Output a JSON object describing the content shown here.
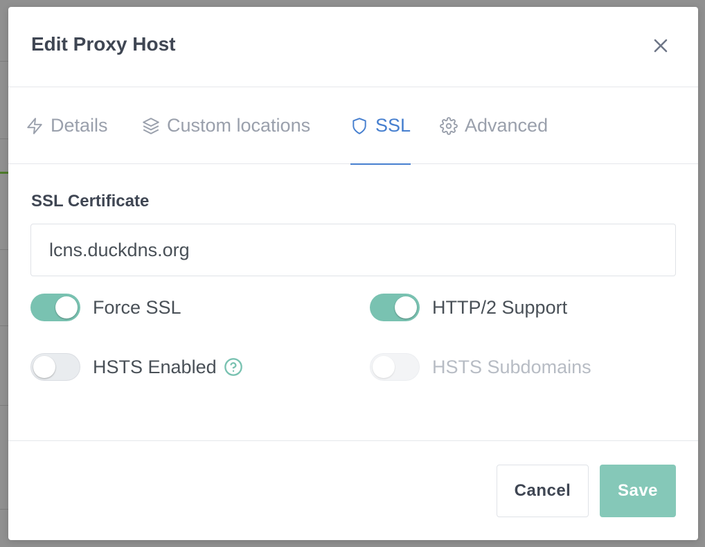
{
  "modal": {
    "title": "Edit Proxy Host",
    "close_icon": "close-icon"
  },
  "tabs": [
    {
      "label": "Details",
      "icon": "lightning-icon",
      "active": false
    },
    {
      "label": "Custom locations",
      "icon": "layers-icon",
      "active": false
    },
    {
      "label": "SSL",
      "icon": "shield-icon",
      "active": true
    },
    {
      "label": "Advanced",
      "icon": "gear-icon",
      "active": false
    }
  ],
  "ssl": {
    "certificate_label": "SSL Certificate",
    "certificate_value": "lcns.duckdns.org",
    "switches": {
      "force_ssl": {
        "label": "Force SSL",
        "on": true,
        "disabled": false
      },
      "http2": {
        "label": "HTTP/2 Support",
        "on": true,
        "disabled": false
      },
      "hsts": {
        "label": "HSTS Enabled",
        "on": false,
        "disabled": false,
        "help_icon": "help-circle-icon"
      },
      "hsts_subdomains": {
        "label": "HSTS Subdomains",
        "on": false,
        "disabled": true
      }
    }
  },
  "footer": {
    "cancel_label": "Cancel",
    "save_label": "Save"
  },
  "colors": {
    "accent": "#467fcf",
    "switch_on": "#79c2b1",
    "save_button": "#85c8b8",
    "overlay": "#8c8c8c"
  }
}
